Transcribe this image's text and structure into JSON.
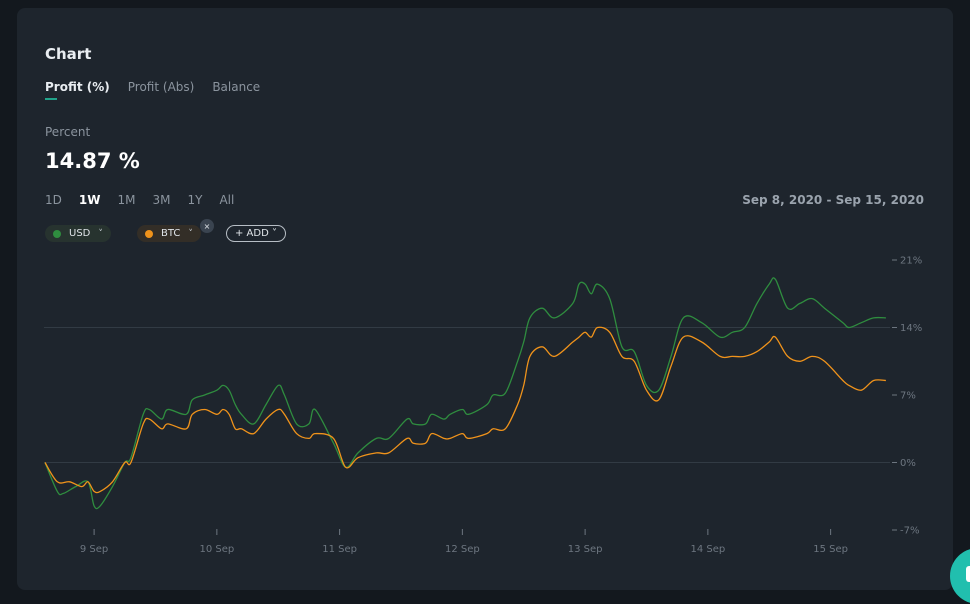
{
  "card": {
    "title": "Chart",
    "tabs": [
      {
        "label": "Profit (%)",
        "active": true
      },
      {
        "label": "Profit (Abs)",
        "active": false
      },
      {
        "label": "Balance",
        "active": false
      }
    ],
    "metric_label": "Percent",
    "metric_value": "14.87 %",
    "ranges": [
      {
        "label": "1D",
        "active": false
      },
      {
        "label": "1W",
        "active": true
      },
      {
        "label": "1M",
        "active": false
      },
      {
        "label": "3M",
        "active": false
      },
      {
        "label": "1Y",
        "active": false
      },
      {
        "label": "All",
        "active": false
      }
    ],
    "date_range": "Sep 8, 2020 - Sep 15, 2020",
    "chips": {
      "usd": {
        "label": "USD",
        "chevron": "˅",
        "color": "#2f8d3f",
        "icon": "chevron-down-icon"
      },
      "btc": {
        "label": "BTC",
        "chevron": "˅",
        "color": "#f0931b",
        "icon": "chevron-down-icon"
      },
      "close": "×",
      "add": "+ ADD ˅"
    }
  },
  "chart_data": {
    "type": "line",
    "ylim": [
      -7,
      21
    ],
    "yticks": [
      21,
      14,
      7,
      0,
      -7
    ],
    "ytick_labels": [
      "21%",
      "14%",
      "7%",
      "0%",
      "-7%"
    ],
    "xticks": [
      1,
      2,
      3,
      4,
      5,
      6,
      7
    ],
    "xtick_labels": [
      "9 Sep",
      "10 Sep",
      "11 Sep",
      "12 Sep",
      "13 Sep",
      "14 Sep",
      "15 Sep"
    ],
    "xlim": [
      0.6,
      7.5
    ],
    "grid_lines": [
      14,
      0
    ],
    "series": [
      {
        "name": "USD",
        "color": "#2f8d3f",
        "x": [
          0.6,
          0.7,
          0.75,
          0.85,
          0.95,
          1.0,
          1.05,
          1.15,
          1.25,
          1.3,
          1.4,
          1.45,
          1.55,
          1.6,
          1.75,
          1.8,
          1.9,
          2.0,
          2.05,
          2.1,
          2.15,
          2.2,
          2.3,
          2.4,
          2.5,
          2.55,
          2.65,
          2.75,
          2.8,
          2.95,
          3.05,
          3.15,
          3.3,
          3.4,
          3.55,
          3.6,
          3.7,
          3.75,
          3.85,
          3.9,
          4.0,
          4.05,
          4.2,
          4.25,
          4.35,
          4.45,
          4.5,
          4.55,
          4.65,
          4.75,
          4.9,
          4.95,
          5.0,
          5.05,
          5.1,
          5.2,
          5.3,
          5.4,
          5.5,
          5.6,
          5.7,
          5.8,
          5.95,
          6.1,
          6.2,
          6.3,
          6.4,
          6.5,
          6.55,
          6.65,
          6.75,
          6.85,
          6.95,
          7.1,
          7.15,
          7.25,
          7.35,
          7.45
        ],
        "y": [
          0,
          -3,
          -3.2,
          -2.5,
          -2,
          -4.5,
          -4.5,
          -2.5,
          0,
          0.5,
          5,
          5.5,
          4.5,
          5.5,
          5,
          6.5,
          7,
          7.5,
          8,
          7.5,
          6,
          5,
          4,
          6,
          8,
          7,
          4,
          4,
          5.5,
          2,
          -0.5,
          1,
          2.5,
          2.5,
          4.5,
          4,
          4,
          5,
          4.5,
          5,
          5.5,
          5,
          6,
          7,
          7.2,
          10.5,
          12.5,
          15,
          16,
          15,
          16.5,
          18.5,
          18.5,
          17.5,
          18.5,
          17,
          12,
          11.5,
          8,
          7.5,
          11,
          15,
          14.5,
          13,
          13.5,
          14,
          16.5,
          18.5,
          19,
          16,
          16.5,
          17,
          16,
          14.5,
          14,
          14.5,
          15,
          15
        ]
      },
      {
        "name": "BTC",
        "color": "#f0931b",
        "x": [
          0.6,
          0.7,
          0.8,
          0.9,
          0.95,
          1.0,
          1.05,
          1.15,
          1.25,
          1.3,
          1.4,
          1.45,
          1.55,
          1.6,
          1.75,
          1.8,
          1.9,
          2.0,
          2.05,
          2.1,
          2.15,
          2.2,
          2.3,
          2.4,
          2.5,
          2.55,
          2.65,
          2.75,
          2.8,
          2.95,
          3.05,
          3.15,
          3.3,
          3.4,
          3.55,
          3.6,
          3.7,
          3.75,
          3.85,
          3.9,
          4.0,
          4.05,
          4.2,
          4.25,
          4.35,
          4.45,
          4.5,
          4.55,
          4.65,
          4.75,
          4.9,
          4.95,
          5.0,
          5.05,
          5.1,
          5.2,
          5.3,
          5.4,
          5.5,
          5.6,
          5.7,
          5.8,
          5.95,
          6.1,
          6.2,
          6.3,
          6.4,
          6.5,
          6.55,
          6.65,
          6.75,
          6.85,
          6.95,
          7.1,
          7.15,
          7.25,
          7.35,
          7.45
        ],
        "y": [
          0,
          -2,
          -2,
          -2.5,
          -2,
          -3,
          -3,
          -2,
          0,
          0,
          4,
          4.5,
          3.5,
          4,
          3.5,
          5,
          5.5,
          5,
          5.5,
          5,
          3.5,
          3.5,
          3,
          4.5,
          5.5,
          5,
          3,
          2.5,
          3,
          2.5,
          -0.5,
          0.5,
          1,
          1,
          2.5,
          2,
          2,
          3,
          2.5,
          2.5,
          3,
          2.5,
          3,
          3.5,
          3.5,
          6,
          8,
          11,
          12,
          11,
          12.5,
          13,
          13.5,
          13,
          14,
          13.5,
          11,
          10.5,
          7.5,
          6.5,
          10,
          13,
          12.5,
          11,
          11,
          11,
          11.5,
          12.5,
          13,
          11,
          10.5,
          11,
          10.5,
          8.5,
          8,
          7.5,
          8.5,
          8.5
        ]
      }
    ]
  }
}
